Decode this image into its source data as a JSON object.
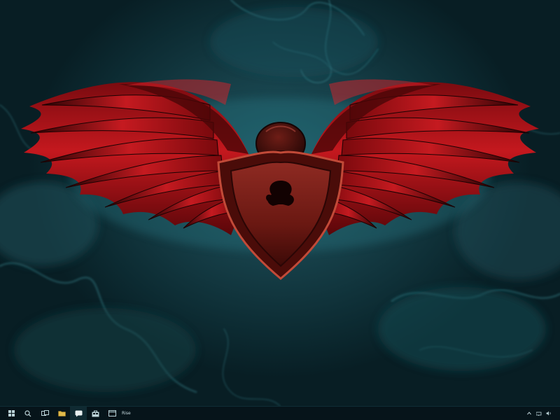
{
  "desktop": {
    "wallpaper": "red-winged-shield-emblem",
    "colors": {
      "background": "#0b2a31",
      "smoke": "#3d8f98",
      "wing_red": "#b5141a",
      "wing_dark": "#3a0606"
    },
    "code_overlay_left": "",
    "code_overlay_right": ""
  },
  "taskbar": {
    "start_icon": "windows-start-icon",
    "buttons": [
      {
        "icon": "search-icon"
      },
      {
        "icon": "task-view-icon"
      },
      {
        "icon": "file-explorer-icon"
      },
      {
        "icon": "chat-icon"
      },
      {
        "icon": "store-icon"
      },
      {
        "icon": "app-window-icon"
      }
    ],
    "app_label": "Rise",
    "tray": {
      "icons": [
        "chevron-up-icon",
        "network-icon",
        "volume-icon"
      ],
      "time": "",
      "date": ""
    }
  }
}
